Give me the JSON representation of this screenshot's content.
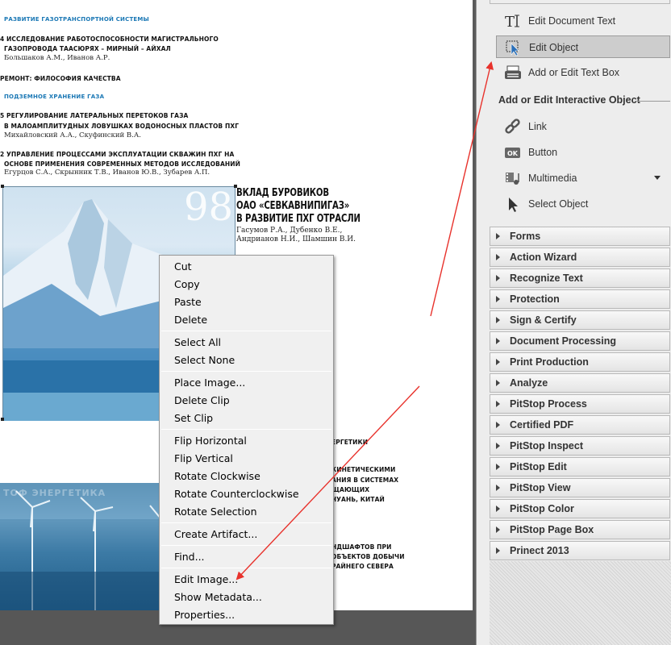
{
  "document": {
    "sections": [
      {
        "text": "РАЗВИТИЕ ГАЗОТРАНСПОРТНОЙ СИСТЕМЫ"
      },
      {
        "text": "ПОДЗЕМНОЕ ХРАНЕНИЕ ГАЗА"
      }
    ],
    "articles": [
      {
        "line1": "4 ИССЛЕДОВАНИЕ РАБОТОСПОСОБНОСТИ МАГИСТРАЛЬНОГО",
        "line2": "ГАЗОПРОВОДА ТААСЮРЯХ – МИРНЫЙ – АЙХАЛ",
        "authors": "Большаков А.М., Иванов А.Р."
      },
      {
        "line1": "РЕМОНТ: ФИЛОСОФИЯ КАЧЕСТВА"
      },
      {
        "line1": "5 РЕГУЛИРОВАНИЕ ЛАТЕРАЛЬНЫХ ПЕРЕТОКОВ ГАЗА",
        "line2": "В МАЛОАМПЛИТУДНЫХ ЛОВУШКАХ ВОДОНОСНЫХ ПЛАСТОВ ПХГ",
        "authors": "Михайловский А.А., Скуфинский В.А."
      },
      {
        "line1": "2 УПРАВЛЕНИЕ ПРОЦЕССАМИ ЭКСПЛУАТАЦИИ СКВАЖИН ПХГ НА",
        "line2": "ОСНОВЕ ПРИМЕНЕНИЯ СОВРЕМЕННЫХ МЕТОДОВ ИССЛЕДОВАНИЙ",
        "authors": "Егурцов С.А., Скрынник Т.В., Иванов Ю.В., Зубарев А.П."
      }
    ],
    "feature": {
      "number": "98",
      "title": [
        "ВКЛАД БУРОВИКОВ",
        "ОАО «СЕВКАВНИПИГАЗ»",
        "В РАЗВИТИЕ ПХГ ОТРАСЛИ"
      ],
      "authors": [
        "Гасумов Р.А., Дубенко В.Е.,",
        "Андрианов Н.И., Шамшин В.И."
      ]
    },
    "partial_lines": [
      "ЕРГЕТИКИ",
      "КИНЕТИЧЕСКИМИ",
      "АНИЯ В  СИСТЕМАХ",
      "ЩАЮЩИХ",
      "ЧУАНЬ, КИТАЙ",
      "НДШАФТОВ ПРИ",
      "ОБЪЕКТОВ ДОБЫЧИ",
      "РАЙНЕГО СЕВЕРА"
    ],
    "watermark": "ТОФ ЭНЕРГЕТИКА"
  },
  "context_menu": {
    "groups": [
      [
        {
          "label": "Cut"
        },
        {
          "label": "Copy"
        },
        {
          "label": "Paste"
        },
        {
          "label": "Delete"
        }
      ],
      [
        {
          "label": "Select All"
        },
        {
          "label": "Select None"
        }
      ],
      [
        {
          "label": "Place Image..."
        },
        {
          "label": "Delete Clip"
        },
        {
          "label": "Set Clip"
        }
      ],
      [
        {
          "label": "Flip Horizontal"
        },
        {
          "label": "Flip Vertical"
        },
        {
          "label": "Rotate Clockwise"
        },
        {
          "label": "Rotate Counterclockwise"
        },
        {
          "label": "Rotate Selection"
        }
      ],
      [
        {
          "label": "Create Artifact..."
        }
      ],
      [
        {
          "label": "Find..."
        }
      ],
      [
        {
          "label": "Edit Image..."
        },
        {
          "label": "Show Metadata..."
        },
        {
          "label": "Properties..."
        }
      ]
    ]
  },
  "right_panel": {
    "tools": [
      {
        "label": "Edit Document Text",
        "icon": "text-edit-icon"
      },
      {
        "label": "Edit Object",
        "icon": "object-cursor-icon",
        "active": true
      },
      {
        "label": "Add or Edit Text Box",
        "icon": "typewriter-icon"
      }
    ],
    "interactive_heading": "Add or Edit Interactive Object",
    "interactive_tools": [
      {
        "label": "Link",
        "icon": "link-icon"
      },
      {
        "label": "Button",
        "icon": "ok-button-icon"
      },
      {
        "label": "Multimedia",
        "icon": "multimedia-icon",
        "has_dropdown": true
      },
      {
        "label": "Select Object",
        "icon": "arrow-cursor-icon"
      }
    ],
    "panels": [
      {
        "label": "Forms"
      },
      {
        "label": "Action Wizard"
      },
      {
        "label": "Recognize Text"
      },
      {
        "label": "Protection"
      },
      {
        "label": "Sign & Certify"
      },
      {
        "label": "Document Processing"
      },
      {
        "label": "Print Production"
      },
      {
        "label": "Analyze"
      },
      {
        "label": "PitStop Process"
      },
      {
        "label": "Certified PDF"
      },
      {
        "label": "PitStop Inspect"
      },
      {
        "label": "PitStop Edit"
      },
      {
        "label": "PitStop View"
      },
      {
        "label": "PitStop Color"
      },
      {
        "label": "PitStop Page Box"
      },
      {
        "label": "Prinect 2013"
      }
    ]
  },
  "colors": {
    "section_blue": "#1b78b5",
    "annotation_red": "#e8322c",
    "active_tool_bg": "#cdcdcd"
  }
}
